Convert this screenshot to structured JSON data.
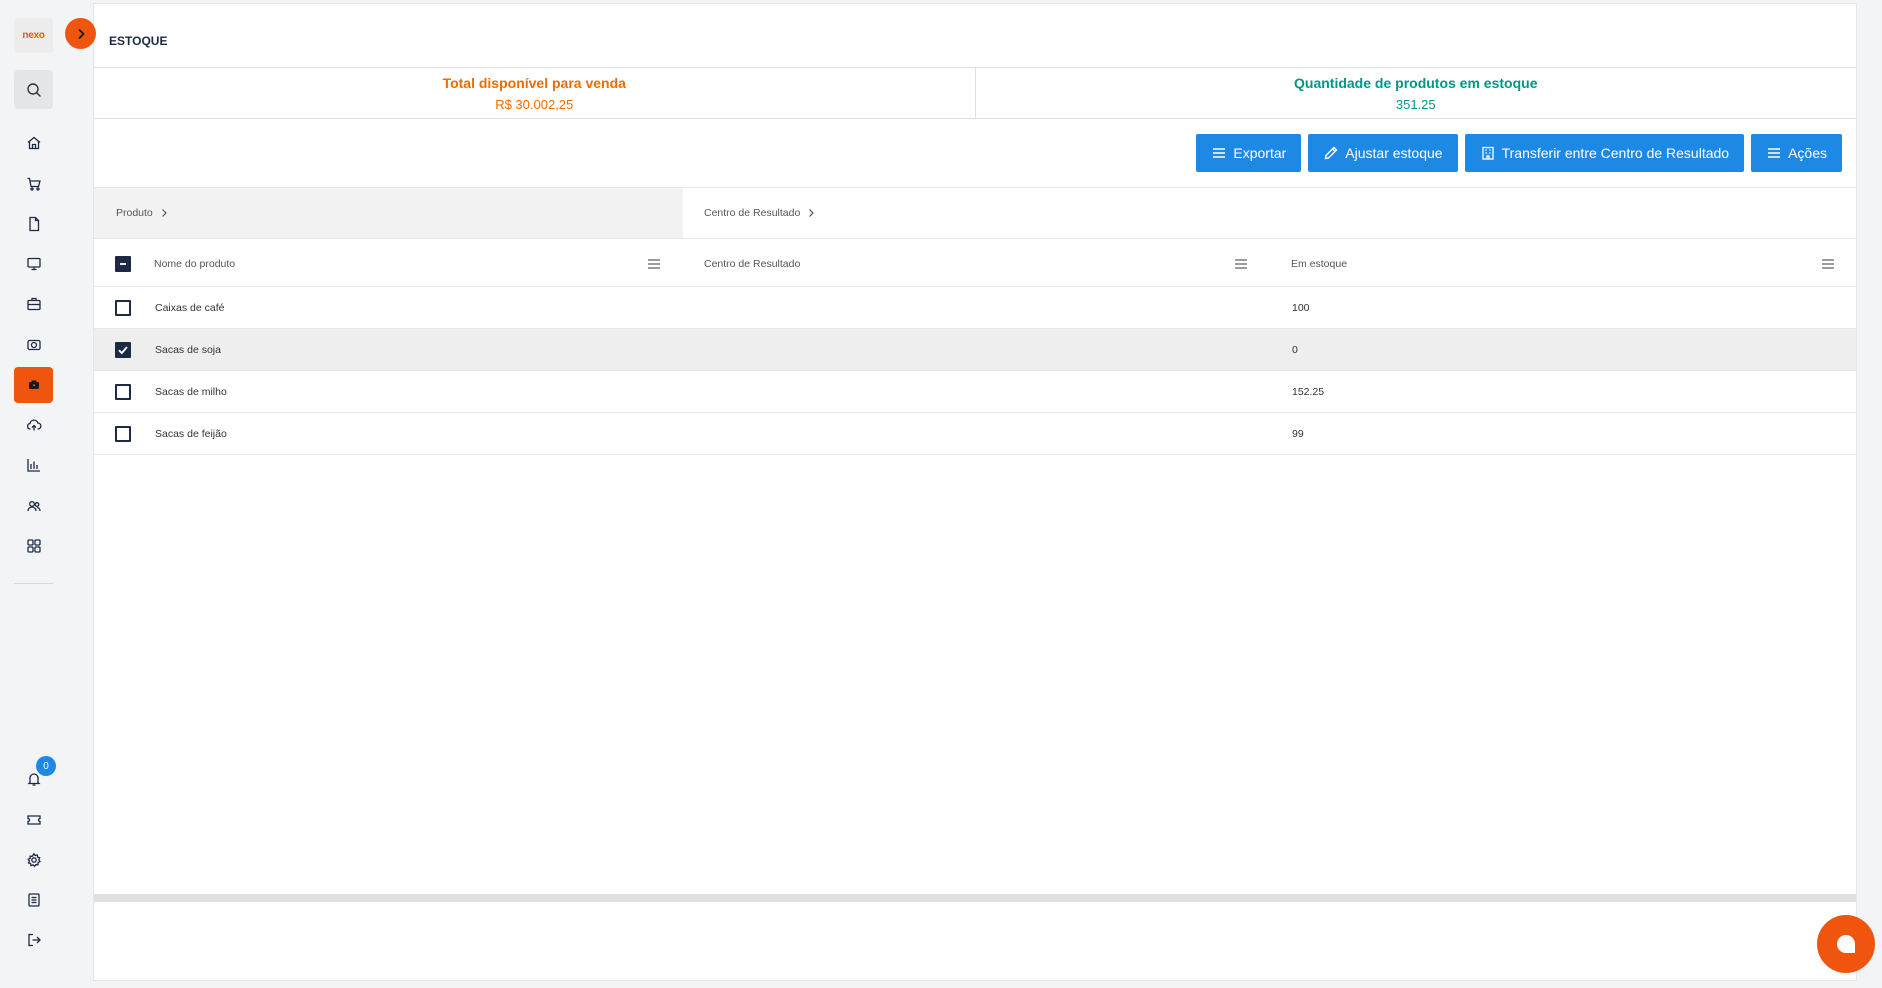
{
  "app": {
    "logo_text": "nexo"
  },
  "page": {
    "title": "ESTOQUE"
  },
  "summary": {
    "total_label": "Total disponível para venda",
    "total_value": "R$ 30.002,25",
    "qty_label": "Quantidade de produtos em estoque",
    "qty_value": "351.25",
    "colors": {
      "total": "#ef6c00",
      "qty": "#009688"
    }
  },
  "toolbar": {
    "export": "Exportar",
    "adjust": "Ajustar estoque",
    "transfer": "Transferir entre Centro de Resultado",
    "actions": "Ações"
  },
  "grouping": {
    "col1": "Produto",
    "col2": "Centro de Resultado"
  },
  "table": {
    "headers": {
      "name": "Nome do produto",
      "center": "Centro de Resultado",
      "stock": "Em estoque"
    },
    "rows": [
      {
        "name": "Caixas de café",
        "center": "",
        "stock": "100",
        "checked": false
      },
      {
        "name": "Sacas de soja",
        "center": "",
        "stock": "0",
        "checked": true
      },
      {
        "name": "Sacas de milho",
        "center": "",
        "stock": "152.25",
        "checked": false
      },
      {
        "name": "Sacas de feijão",
        "center": "",
        "stock": "99",
        "checked": false
      }
    ]
  },
  "sidebar": {
    "items": [
      "home-icon",
      "cart-icon",
      "document-icon",
      "monitor-icon",
      "briefcase-icon",
      "camera-icon",
      "inventory-icon",
      "cloud-upload-icon",
      "chart-icon",
      "users-icon",
      "grid-icon"
    ],
    "active": "inventory-icon",
    "bottom_items": [
      "bell-icon",
      "ticket-icon",
      "gear-icon",
      "list-icon",
      "logout-icon"
    ],
    "notification_count": "0"
  },
  "colors": {
    "accent": "#f0550f",
    "primary": "#1e88e5",
    "dark": "#1d2a44"
  }
}
